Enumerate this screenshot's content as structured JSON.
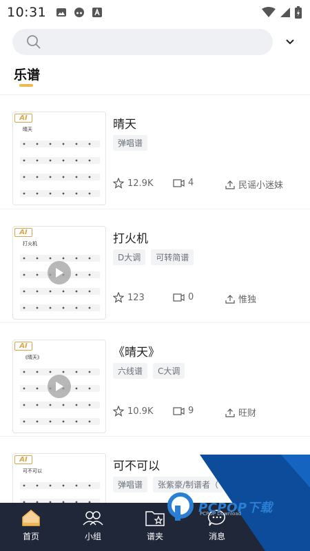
{
  "status_bar": {
    "time": "10:31",
    "icons": [
      "image-icon",
      "headset-app-icon",
      "text-app-icon",
      "wifi-icon",
      "signal-icon",
      "battery-charging-icon"
    ]
  },
  "search": {
    "placeholder": ""
  },
  "tab": {
    "label": "乐谱"
  },
  "items": [
    {
      "title": "晴天",
      "tags": [
        "弹唱谱"
      ],
      "favorites": "12.9K",
      "comments": "4",
      "uploader": "民谣小迷妹",
      "badge": "AI",
      "has_play": false,
      "thumb_title": "晴天"
    },
    {
      "title": "打火机",
      "tags": [
        "D大调",
        "可转简谱"
      ],
      "favorites": "123",
      "comments": "0",
      "uploader": "惟独",
      "badge": "AI",
      "has_play": true,
      "thumb_title": "打火机"
    },
    {
      "title": "《晴天》",
      "tags": [
        "六线谱",
        "C大调"
      ],
      "favorites": "10.9K",
      "comments": "9",
      "uploader": "旺财",
      "badge": "AI",
      "has_play": true,
      "thumb_title": "《晴天》"
    },
    {
      "title": "可不可以",
      "tags": [
        "弹唱谱",
        "张紫豪/制谱者（"
      ],
      "favorites": "",
      "comments": "",
      "uploader": "",
      "badge": "AI",
      "has_play": false,
      "thumb_title": "可不可以"
    }
  ],
  "bottom_nav": [
    {
      "label": "首页",
      "icon": "home-icon",
      "active": true
    },
    {
      "label": "小组",
      "icon": "group-icon",
      "active": false
    },
    {
      "label": "谱夹",
      "icon": "folder-star-icon",
      "active": false
    },
    {
      "label": "消息",
      "icon": "message-icon",
      "active": false
    }
  ],
  "watermark": {
    "text": "PCPOP下载",
    "sub": "PCPOP Download"
  },
  "colors": {
    "accent": "#f0b84e",
    "nav_bg": "#202738",
    "watermark_blue": "#0d4c9a"
  }
}
